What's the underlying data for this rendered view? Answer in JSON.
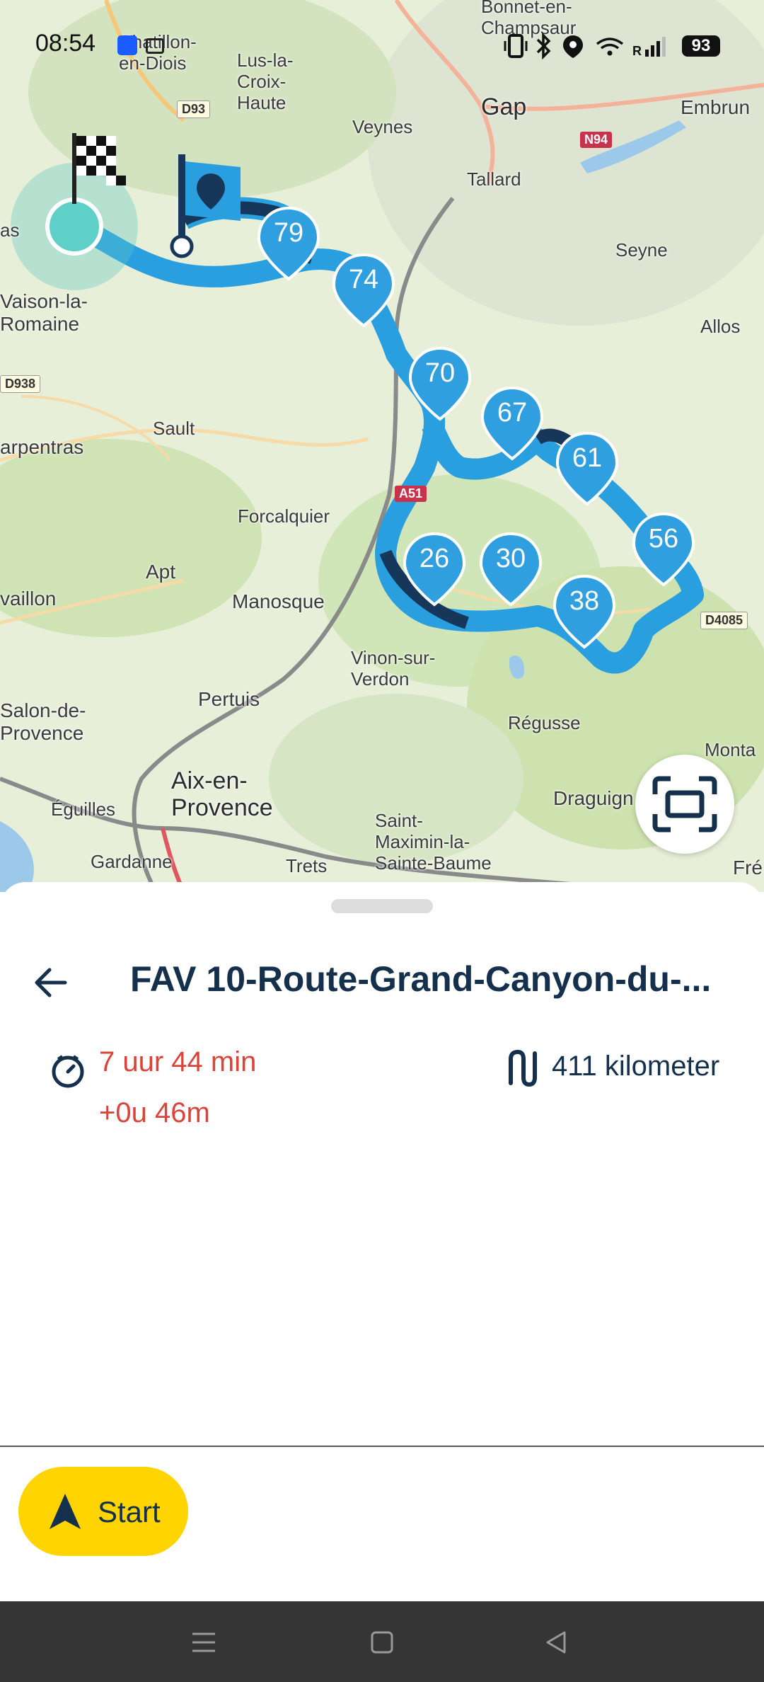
{
  "status_bar": {
    "time": "08:54",
    "battery": "93",
    "icons": [
      "vibrate-icon",
      "bluetooth-icon",
      "location-icon",
      "wifi-icon",
      "signal-icon"
    ]
  },
  "map": {
    "places": {
      "chatillon": "Chatillon-\nen-Diois",
      "lus": "Lus-la-\nCroix-\nHaute",
      "bonnet": "Bonnet-en-\nChampsaur",
      "veynes": "Veynes",
      "gap": "Gap",
      "embrun": "Embrun",
      "tallard": "Tallard",
      "seyne": "Seyne",
      "allos": "Allos",
      "vaison": "Vaison-la-\nRomaine",
      "sault": "Sault",
      "carpentras": "arpentras",
      "forcalquier": "Forcalquier",
      "apt": "Apt",
      "cavaillon": "vaillon",
      "manosque": "Manosque",
      "vinon": "Vinon-sur-\nVerdon",
      "pertuis": "Pertuis",
      "salon": "Salon-de-\nProvence",
      "regusse": "Régusse",
      "aix": "Aix-en-\nProvence",
      "eguilles": "Éguilles",
      "gardanne": "Gardanne",
      "trets": "Trets",
      "saint_maximin": "Saint-\nMaximin-la-\nSainte-Baume",
      "draguignan": "Draguign",
      "montauroux": "Monta",
      "frejus": "Fré",
      "as": "as"
    },
    "roads": {
      "d93": "D93",
      "n94": "N94",
      "a51": "A51",
      "d938": "D938",
      "d4085": "D4085"
    },
    "waypoints": [
      "79",
      "74",
      "70",
      "67",
      "61",
      "56",
      "38",
      "30",
      "26"
    ],
    "accent_color": "#2f9fe0",
    "route_color": "#17375a"
  },
  "sheet": {
    "title": "FAV 10-Route-Grand-Canyon-du-...",
    "duration": "7 uur 44 min",
    "delay": "+0u 46m",
    "distance": "411 kilometer",
    "start_label": "Start"
  },
  "colors": {
    "start_button": "#ffd400",
    "title": "#15304d",
    "duration": "#d9453a"
  }
}
